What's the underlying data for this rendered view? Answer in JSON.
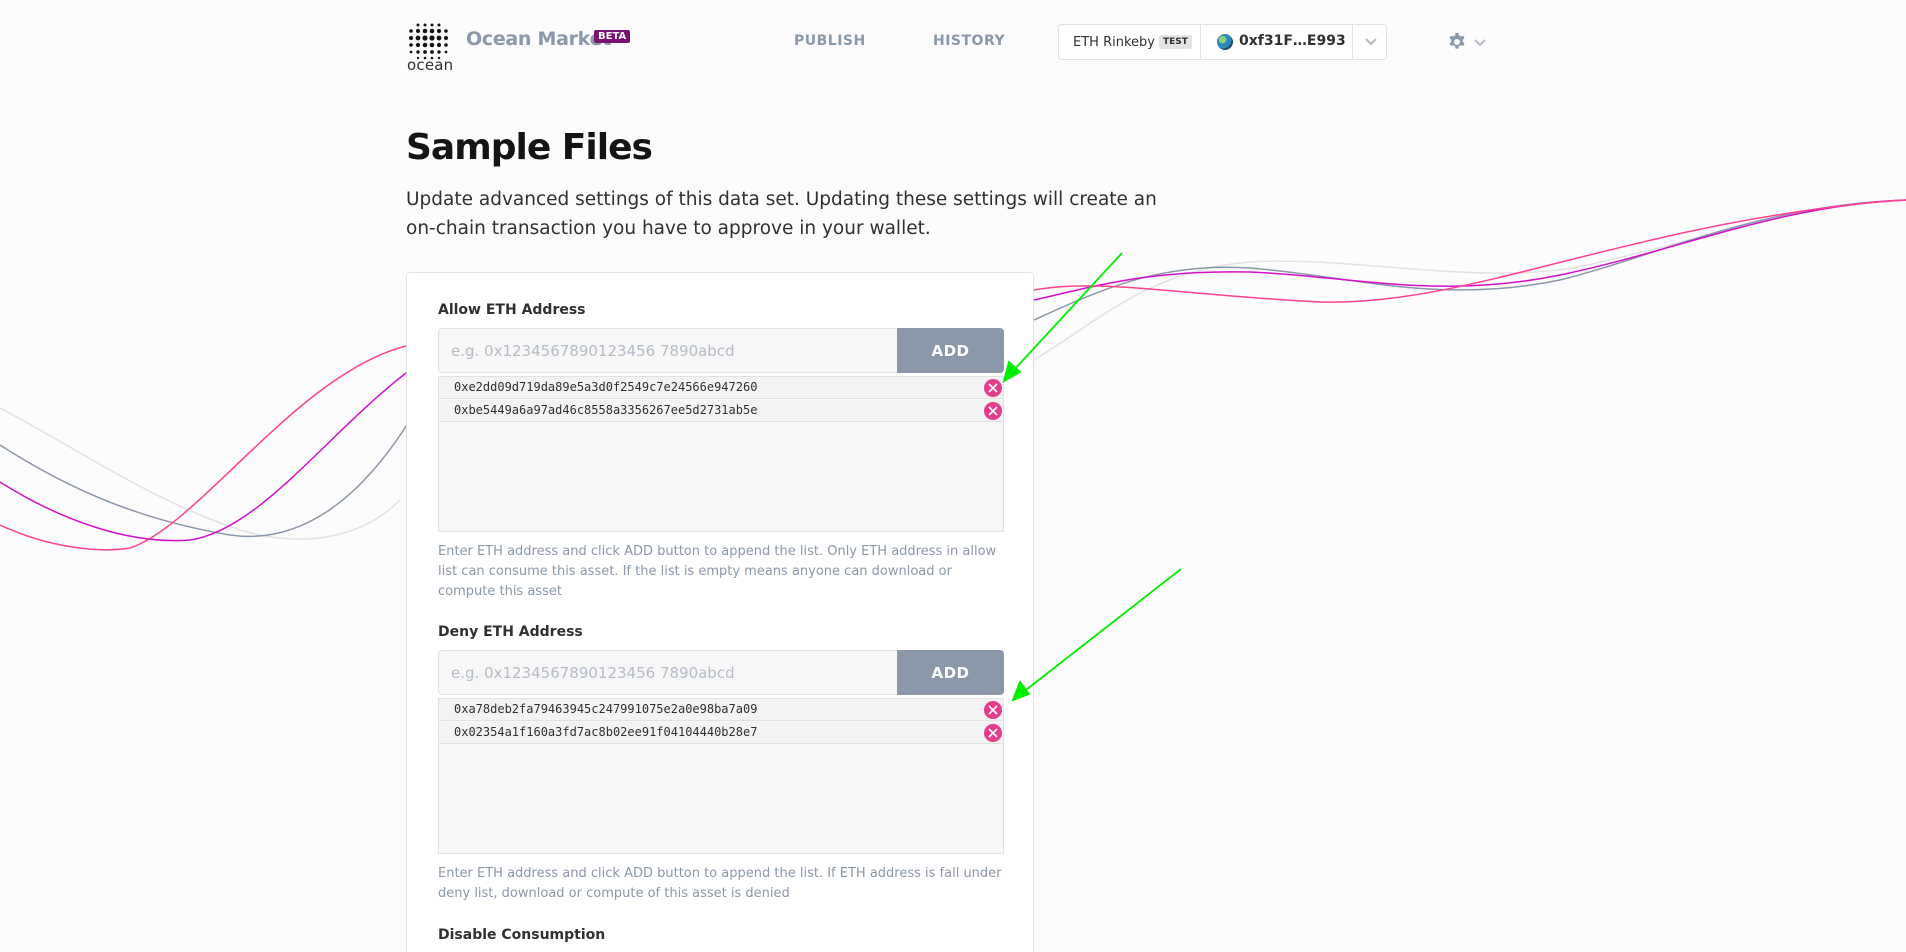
{
  "header": {
    "logo_word": "ocean",
    "brand": "Ocean Market",
    "beta": "BETA",
    "nav": [
      {
        "label": "PUBLISH"
      },
      {
        "label": "HISTORY"
      }
    ],
    "wallet": {
      "network": "ETH Rinkeby",
      "network_badge": "TEST",
      "address": "0xf31F…E993"
    }
  },
  "page": {
    "title": "Sample Files",
    "intro": "Update advanced settings of this data set. Updating these settings will create an on-chain transaction you have to approve in your wallet."
  },
  "allow": {
    "label": "Allow ETH Address",
    "placeholder": "e.g. 0x1234567890123456 7890abcd",
    "add_label": "ADD",
    "items": [
      "0xe2dd09d719da89e5a3d0f2549c7e24566e947260",
      "0xbe5449a6a97ad46c8558a3356267ee5d2731ab5e"
    ],
    "help": "Enter ETH address and click ADD button to append the list. Only ETH address in allow list can consume this asset. If the list is empty means anyone can download or compute this asset"
  },
  "deny": {
    "label": "Deny ETH Address",
    "placeholder": "e.g. 0x1234567890123456 7890abcd",
    "add_label": "ADD",
    "items": [
      "0xa78deb2fa79463945c247991075e2a0e98ba7a09",
      "0x02354a1f160a3fd7ac8b02ee91f04104440b28e7"
    ],
    "help": "Enter ETH address and click ADD button to append the list. If ETH address is fall under deny list, download or compute of this asset is denied"
  },
  "disable": {
    "label": "Disable Consumption"
  },
  "colors": {
    "accent_pink": "#e43d8b",
    "brand_purple": "#7b1173",
    "slate": "#8b98a9",
    "annotation_green": "#00ee00"
  },
  "icons": {
    "logo": "ocean-dots-logo",
    "network": "globe-icon",
    "wallet_menu": "chevron-down-icon",
    "settings": "gear-icon",
    "remove": "close-icon"
  }
}
